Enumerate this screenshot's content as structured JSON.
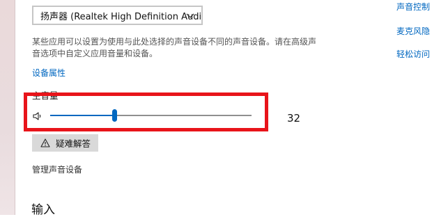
{
  "output": {
    "device_select_value": "扬声器 (Realtek High Definition Audi...",
    "description": "某些应用可以设置为使用与此处选择的声音设备不同的声音设备。请在高级声音选项中自定义应用音量和设备。",
    "device_properties_link": "设备属性",
    "master_volume_label": "主音量",
    "volume_value": "32",
    "volume_level_percent": 32,
    "troubleshoot_button": "疑难解答",
    "manage_devices_link": "管理声音设备"
  },
  "input": {
    "heading": "输入"
  },
  "related_links": [
    "声音控制",
    "麦克风隐",
    "轻松访问"
  ],
  "colors": {
    "accent": "#0067c0",
    "highlight_box": "#e8141a"
  },
  "icons": [
    "chevron-down-icon",
    "speaker-icon",
    "warning-icon"
  ]
}
